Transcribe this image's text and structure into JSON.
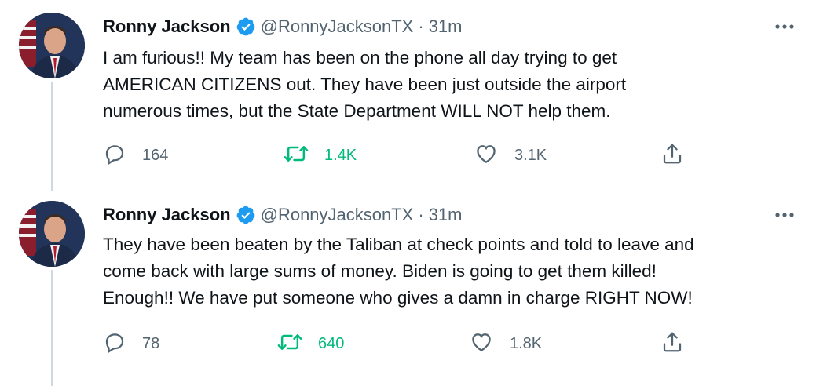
{
  "tweets": [
    {
      "name": "Ronny Jackson",
      "handle": "@RonnyJacksonTX",
      "separator": "·",
      "time": "31m",
      "text_lines": [
        "I am furious!! My team has been on the phone all day trying to get",
        "AMERICAN CITIZENS out. They have been just outside the airport",
        "numerous times, but the State Department WILL NOT help them."
      ],
      "replies": "164",
      "retweets": "1.4K",
      "likes": "3.1K"
    },
    {
      "name": "Ronny Jackson",
      "handle": "@RonnyJacksonTX",
      "separator": "·",
      "time": "31m",
      "text_lines": [
        "They have been beaten by the Taliban at check points and told to leave and",
        "come back with large sums of money. Biden is going to get them killed!",
        "Enough!! We have put someone who gives a damn in charge RIGHT NOW!"
      ],
      "replies": "78",
      "retweets": "640",
      "likes": "1.8K"
    }
  ],
  "colors": {
    "verified": "#1d9bf0",
    "retweet_active": "#00ba7c",
    "secondary_text": "#536471",
    "thread_line": "#cfd9de"
  },
  "icons": [
    "verified-badge-icon",
    "more-icon",
    "reply-icon",
    "retweet-icon",
    "like-icon",
    "share-icon"
  ]
}
